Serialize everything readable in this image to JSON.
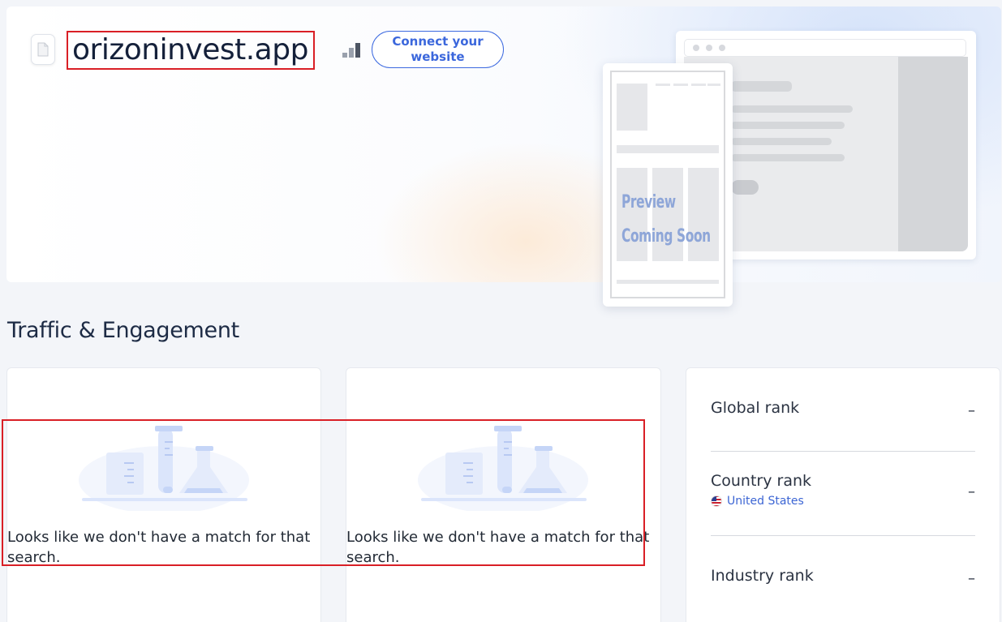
{
  "hero": {
    "domain": "orizoninvest.app",
    "connect_button": "Connect your website",
    "preview": {
      "line1": "Preview",
      "line2": "Coming Soon"
    }
  },
  "section": {
    "title": "Traffic & Engagement"
  },
  "cards": [
    {
      "message": "Looks like we don't have a match for that search."
    },
    {
      "message": "Looks like we don't have a match for that search."
    }
  ],
  "ranks": {
    "global": {
      "label": "Global rank",
      "value": "–"
    },
    "country": {
      "label": "Country rank",
      "country": "United States",
      "value": "–"
    },
    "industry": {
      "label": "Industry rank",
      "value": "–"
    }
  },
  "colors": {
    "accent": "#3b67dc",
    "highlight": "#d91f26",
    "illustration": "#cfdcf8"
  }
}
